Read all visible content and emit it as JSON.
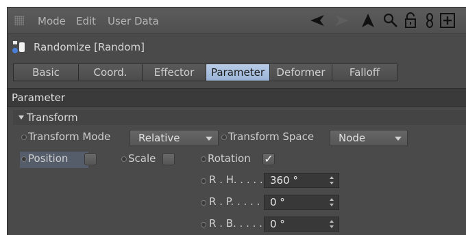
{
  "menu": {
    "mode": "Mode",
    "edit": "Edit",
    "user_data": "User Data"
  },
  "toolbar_icons": [
    "arrow-left-icon",
    "arrow-right-icon",
    "arrow-up-icon",
    "search-icon",
    "lock-icon",
    "link-icon",
    "add-panel-icon"
  ],
  "object": {
    "title": "Randomize [Random]",
    "icon": "randomize-effector-icon"
  },
  "tabs": [
    "Basic",
    "Coord.",
    "Effector",
    "Parameter",
    "Deformer",
    "Falloff"
  ],
  "active_tab": "Parameter",
  "section": {
    "title": "Parameter"
  },
  "group": {
    "title": "Transform"
  },
  "params": {
    "transform_mode": {
      "label": "Transform Mode",
      "value": "Relative"
    },
    "transform_space": {
      "label": "Transform Space",
      "value": "Node"
    },
    "position": {
      "label": "Position",
      "checked": false
    },
    "scale": {
      "label": "Scale",
      "checked": false
    },
    "rotation": {
      "label": "Rotation",
      "checked": true,
      "check_glyph": "✓"
    },
    "rh": {
      "label": "R . H. . . . .",
      "value": "360 °"
    },
    "rp": {
      "label": "R . P. . . . .",
      "value": "0 °"
    },
    "rb": {
      "label": "R . B. . . . .",
      "value": "0 °"
    }
  },
  "colors": {
    "active_tab": "#a9c0de",
    "panel_bg": "#4a4a4a",
    "section_bg": "#3a3a3a"
  }
}
